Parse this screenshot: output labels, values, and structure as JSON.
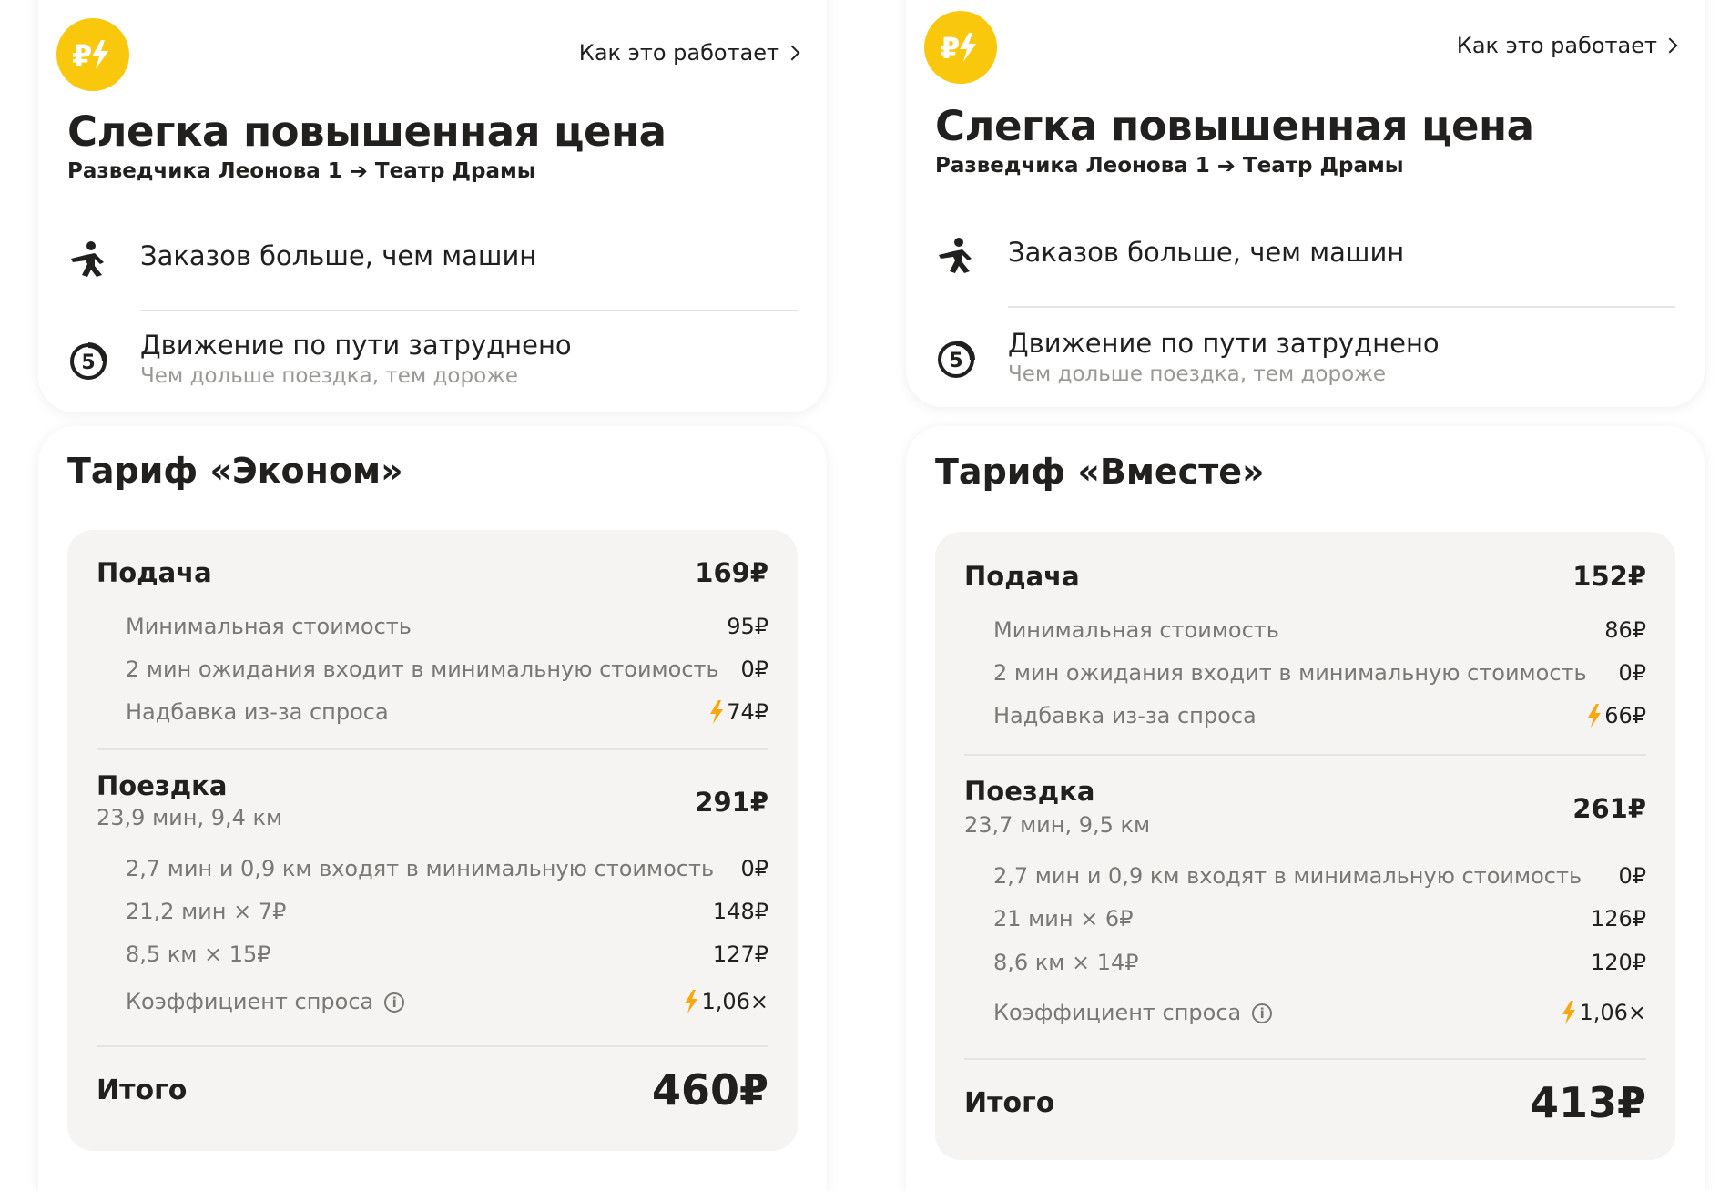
{
  "colors": {
    "accent": "#f9c70c",
    "text": "#21201f",
    "muted": "#7a7874",
    "panel_bg": "#f5f4f2"
  },
  "panels": [
    {
      "icon": "surge-price-icon",
      "how_link": "Как это работает",
      "title": "Слегка повышенная цена",
      "route_from": "Разведчика Леонова 1",
      "route_to": "Театр Драмы",
      "reasons": [
        {
          "icon": "person-hailing-icon",
          "text": "Заказов больше, чем машин"
        },
        {
          "icon": "traffic-score-icon",
          "badge": "5",
          "text": "Движение по пути затруднено",
          "sub": "Чем дольше поездка, тем дороже"
        }
      ],
      "tariff": "Тариф «Эконом»",
      "pickup": {
        "label": "Подача",
        "value": "169₽",
        "items": [
          {
            "label": "Минимальная стоимость",
            "value": "95₽"
          },
          {
            "label": "2 мин ожидания входит в минимальную стоимость",
            "value": "0₽"
          },
          {
            "label": "Надбавка из-за спроса",
            "value": "74₽",
            "surge": true
          }
        ]
      },
      "ride": {
        "label": "Поездка",
        "detail": "23,9 мин, 9,4 км",
        "value": "291₽",
        "items": [
          {
            "label": "2,7 мин и 0,9 км входят в минимальную стоимость",
            "value": "0₽"
          },
          {
            "label": "21,2 мин × 7₽",
            "value": "148₽"
          },
          {
            "label": "8,5 км × 15₽",
            "value": "127₽"
          },
          {
            "label": "Коэффициент спроса",
            "value": "1,06×",
            "surge": true,
            "info": true
          }
        ]
      },
      "total": {
        "label": "Итого",
        "value": "460₽"
      }
    },
    {
      "icon": "surge-price-icon",
      "how_link": "Как это работает",
      "title": "Слегка повышенная цена",
      "route_from": "Разведчика Леонова 1",
      "route_to": "Театр Драмы",
      "reasons": [
        {
          "icon": "person-hailing-icon",
          "text": "Заказов больше, чем машин"
        },
        {
          "icon": "traffic-score-icon",
          "badge": "5",
          "text": "Движение по пути затруднено",
          "sub": "Чем дольше поездка, тем дороже"
        }
      ],
      "tariff": "Тариф «Вместе»",
      "pickup": {
        "label": "Подача",
        "value": "152₽",
        "items": [
          {
            "label": "Минимальная стоимость",
            "value": "86₽"
          },
          {
            "label": "2 мин ожидания входит в минимальную стоимость",
            "value": "0₽"
          },
          {
            "label": "Надбавка из-за спроса",
            "value": "66₽",
            "surge": true
          }
        ]
      },
      "ride": {
        "label": "Поездка",
        "detail": "23,7 мин, 9,5 км",
        "value": "261₽",
        "items": [
          {
            "label": "2,7 мин и 0,9 км входят в минимальную стоимость",
            "value": "0₽"
          },
          {
            "label": "21 мин × 6₽",
            "value": "126₽"
          },
          {
            "label": "8,6 км × 14₽",
            "value": "120₽"
          },
          {
            "label": "Коэффициент спроса",
            "value": "1,06×",
            "surge": true,
            "info": true
          }
        ]
      },
      "total": {
        "label": "Итого",
        "value": "413₽"
      }
    }
  ]
}
